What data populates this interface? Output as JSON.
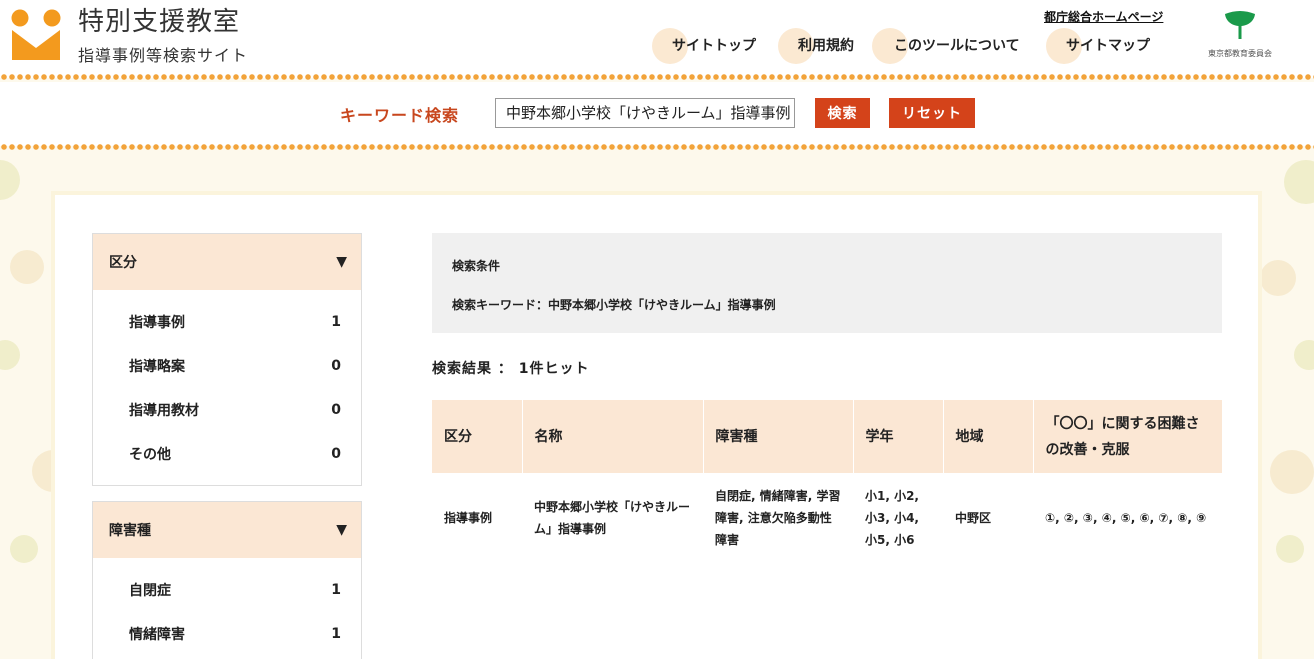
{
  "header": {
    "title": "特別支援教室",
    "subtitle": "指導事例等検索サイト",
    "gov_link": "都庁総合ホームページ",
    "nav": [
      "サイトトップ",
      "利用規約",
      "このツールについて",
      "サイトマップ"
    ],
    "org": "東京都教育委員会"
  },
  "search": {
    "label": "キーワード検索",
    "value": "中野本郷小学校「けやきルーム」指導事例",
    "search_button": "検索",
    "reset_button": "リセット"
  },
  "sidebar": {
    "groups": [
      {
        "title": "区分",
        "items": [
          {
            "label": "指導事例",
            "count": "1"
          },
          {
            "label": "指導略案",
            "count": "0"
          },
          {
            "label": "指導用教材",
            "count": "0"
          },
          {
            "label": "その他",
            "count": "0"
          }
        ]
      },
      {
        "title": "障害種",
        "items": [
          {
            "label": "自閉症",
            "count": "1"
          },
          {
            "label": "情緒障害",
            "count": "1"
          }
        ]
      }
    ]
  },
  "conditions": {
    "title": "検索条件",
    "keyword_line": "検索キーワード：中野本郷小学校「けやきルーム」指導事例"
  },
  "result_count": "検索結果 ： 1件ヒット",
  "table": {
    "headers": [
      "区分",
      "名称",
      "障害種",
      "学年",
      "地域",
      "「〇〇」に関する困難さの改善・克服"
    ],
    "rows": [
      [
        "指導事例",
        "中野本郷小学校「けやきルーム」指導事例",
        "自閉症, 情緒障害, 学習障害, 注意欠陥多動性障害",
        "小1, 小2, 小3, 小4, 小5, 小6",
        "中野区",
        "①, ②, ③, ④, ⑤, ⑥, ⑦, ⑧, ⑨"
      ]
    ]
  },
  "colors": {
    "accent": "#d4431a",
    "logo_orange": "#f39a1e",
    "header_tint": "#fbe7d4",
    "background": "#fdf9ec"
  }
}
